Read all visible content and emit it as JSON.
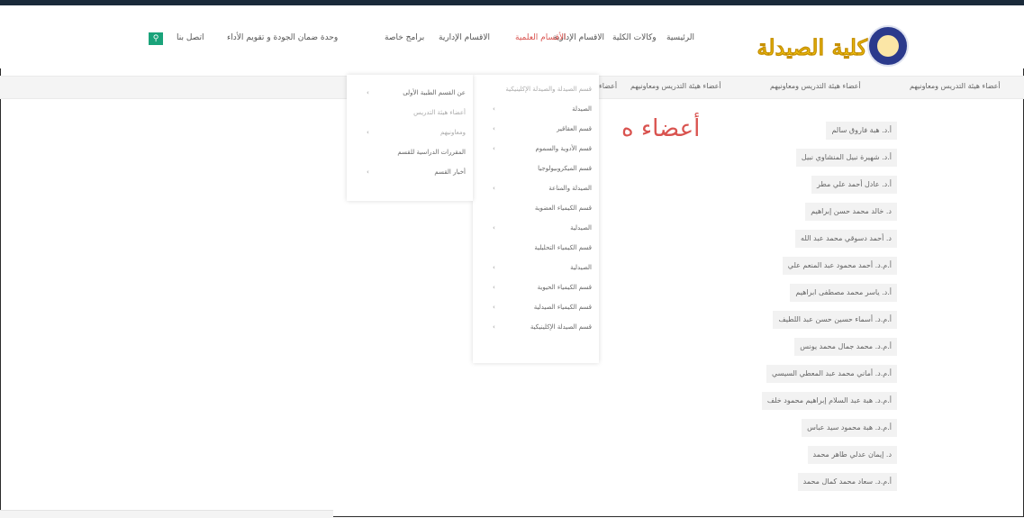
{
  "nav": {
    "items": [
      {
        "label": "الرئيسية",
        "active": false
      },
      {
        "label": "وكالات الكلية",
        "active": false
      },
      {
        "label": "الاقسام الإدارية",
        "active": false
      },
      {
        "label": "الأقسام العلمية",
        "active": true
      },
      {
        "label": "الاقسام الإدارية",
        "active": false
      },
      {
        "label": "برامج خاصة",
        "active": false
      },
      {
        "label": "وحدة ضمان الجودة و تقويم الأداء",
        "active": false
      },
      {
        "label": "اتصل بنا",
        "active": false
      }
    ],
    "search_icon": "search-icon"
  },
  "logo": {
    "text": "كلية الصيدلة",
    "brand_color": "#f2c40f"
  },
  "breadcrumb": [
    "أعضاء هيئة التدريس ومعاونيهم",
    "أعضاء هيئة التدريس ومعاونيهم",
    "أعضاء هيئة التدريس ومعاونيهم",
    "أعضاء"
  ],
  "page_title": "أعضاء ه",
  "members": [
    "أ.د. هبة فاروق سالم",
    "أ.د. شهيرة نبيل المنشاوي نبيل",
    "أ.د. عادل أحمد علي مطر",
    "د. خالد محمد حسن إبراهيم",
    "د. أحمد دسوقي محمد عبد الله",
    "أ.م.د. أحمد محمود عبد المنعم علي",
    "أ.د. ياسر محمد مصطفى ابراهيم",
    "أ.م.د. أسماء حسين حسن عبد اللطيف",
    "أ.م.د. محمد جمال محمد يونس",
    "أ.م.د. أماني محمد عبد المعطي السيسي",
    "أ.م.د. هبة عبد السلام إبراهيم محمود خلف",
    "أ.م.د. هبة محمود سيد عباس",
    "د. إيمان عدلي طاهر محمد",
    "أ.م.د. سعاد محمد كمال محمد"
  ],
  "dropdown_main": [
    {
      "label": "قسم الصيدلة والصيدلة الإكلينيكية",
      "arrow": false,
      "muted": true
    },
    {
      "label": "الصيدلة",
      "arrow": true,
      "muted": false
    },
    {
      "label": "قسم العقاقير",
      "arrow": true,
      "muted": false
    },
    {
      "label": "قسم الأدوية والسموم",
      "arrow": true,
      "muted": false
    },
    {
      "label": "قسم الميكروبيولوجيا",
      "arrow": false,
      "muted": false
    },
    {
      "label": "الصيدلة والمناعة",
      "arrow": true,
      "muted": false
    },
    {
      "label": "قسم الكيمياء العضوية",
      "arrow": false,
      "muted": false
    },
    {
      "label": "الصيدلية",
      "arrow": true,
      "muted": false
    },
    {
      "label": "قسم الكيمياء التحليلية",
      "arrow": false,
      "muted": false
    },
    {
      "label": "الصيدلية",
      "arrow": true,
      "muted": false
    },
    {
      "label": "قسم الكيمياء الحيوية",
      "arrow": true,
      "muted": false
    },
    {
      "label": "قسم الكيمياء الصيدلية",
      "arrow": true,
      "muted": false
    },
    {
      "label": "قسم الصيدلة الإكلينيكية",
      "arrow": true,
      "muted": false
    }
  ],
  "dropdown_sub": [
    {
      "label": "عن القسم الطبية الأولى",
      "arrow": true,
      "muted": false
    },
    {
      "label": "أعضاء هيئة التدريس",
      "arrow": false,
      "muted": true
    },
    {
      "label": "ومعاونيهم",
      "arrow": true,
      "muted": true
    },
    {
      "label": "المقررات الدراسية للقسم",
      "arrow": false,
      "muted": false
    },
    {
      "label": "أخبار القسم",
      "arrow": true,
      "muted": false
    }
  ],
  "colors": {
    "accent": "#d9534f",
    "search": "#1aa37a",
    "nav_text": "#555555"
  }
}
